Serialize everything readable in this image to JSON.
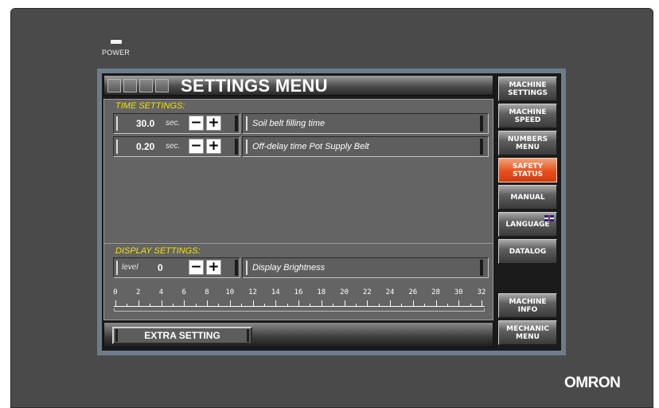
{
  "device": {
    "power_label": "POWER",
    "brand": "OMRON"
  },
  "header": {
    "title": "SETTINGS MENU"
  },
  "time_settings": {
    "title": "TIME SETTINGS:",
    "rows": [
      {
        "value": "30.0",
        "unit": "sec.",
        "description": "Soil belt filling time"
      },
      {
        "value": "0.20",
        "unit": "sec.",
        "description": "Off-delay time Pot Supply Belt"
      }
    ]
  },
  "display_settings": {
    "title": "DISPLAY SETTINGS:",
    "level_label": "level",
    "level_value": "0",
    "description": "Display Brightness",
    "scale_labels": [
      "0",
      "2",
      "4",
      "6",
      "8",
      "10",
      "12",
      "14",
      "16",
      "18",
      "20",
      "22",
      "24",
      "26",
      "28",
      "30",
      "32"
    ],
    "scale_min": 0,
    "scale_max": 32
  },
  "buttons": {
    "minus": "−",
    "plus": "+"
  },
  "footer": {
    "extra_setting": "EXTRA SETTING"
  },
  "side_menu": [
    {
      "label": "MACHINE\nSETTINGS",
      "active": false
    },
    {
      "label": "MACHINE\nSPEED",
      "active": false
    },
    {
      "label": "NUMBERS\nMENU",
      "active": false
    },
    {
      "label": "SAFETY\nSTATUS",
      "active": true
    },
    {
      "label": "MANUAL",
      "active": false
    },
    {
      "label": "LANGUAGE",
      "active": false,
      "icon": "uk-flag-icon"
    },
    {
      "label": "DATALOG",
      "active": false
    },
    {
      "label": "MACHINE\nINFO",
      "active": false
    },
    {
      "label": "MECHANIC\nMENU",
      "active": false
    }
  ],
  "colors": {
    "section_title": "#f3e000",
    "active_button": "#e8501c",
    "screen_frame": "#6d7b8d",
    "bezel": "#4a4a4a"
  }
}
